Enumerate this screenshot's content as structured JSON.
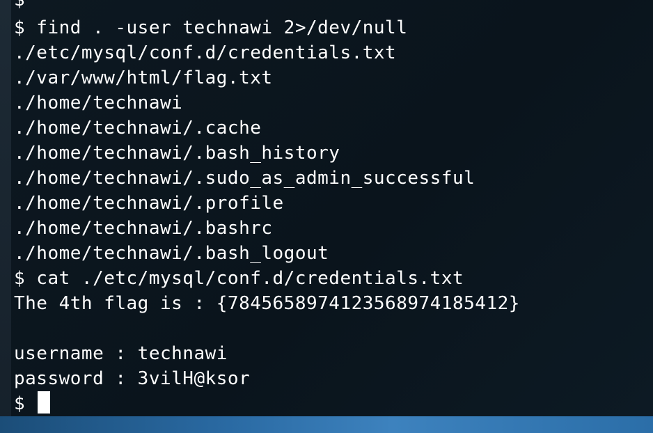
{
  "terminal": {
    "lines": [
      "$",
      "$ find . -user technawi 2>/dev/null",
      "./etc/mysql/conf.d/credentials.txt",
      "./var/www/html/flag.txt",
      "./home/technawi",
      "./home/technawi/.cache",
      "./home/technawi/.bash_history",
      "./home/technawi/.sudo_as_admin_successful",
      "./home/technawi/.profile",
      "./home/technawi/.bashrc",
      "./home/technawi/.bash_logout",
      "$ cat ./etc/mysql/conf.d/credentials.txt",
      "The 4th flag is : {7845658974123568974185412}",
      "",
      "username : technawi",
      "password : 3vilH@ksor"
    ],
    "prompt": "$ "
  }
}
